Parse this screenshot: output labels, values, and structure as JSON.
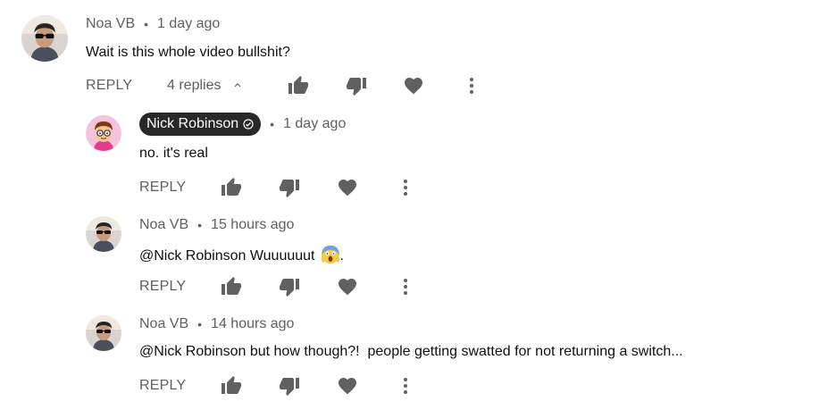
{
  "thread": {
    "top_comment": {
      "author": "Noa VB",
      "separator": "•",
      "time": "1 day ago",
      "text": "Wait is this whole video bullshit?",
      "reply_label": "REPLY",
      "replies_label": "4 replies"
    },
    "replies": [
      {
        "author": "Nick Robinson",
        "separator": "•",
        "time": "1 day ago",
        "text": "no. it's real",
        "reply_label": "REPLY"
      },
      {
        "author": "Noa VB",
        "separator": "•",
        "time": "15 hours ago",
        "text": "@Nick Robinson Wuuuuuut",
        "text_suffix": ".",
        "reply_label": "REPLY"
      },
      {
        "author": "Noa VB",
        "separator": "•",
        "time": "14 hours ago",
        "text": "@Nick Robinson but how though?!  people getting swatted for not returning a switch...",
        "reply_label": "REPLY"
      }
    ]
  },
  "colors": {
    "icon": "#606060",
    "text": "#0f0f0f",
    "meta": "#606060",
    "badge_bg": "#282828"
  },
  "icons": [
    "like-icon",
    "dislike-icon",
    "heart-icon",
    "more-vert-icon",
    "chevron-up-icon",
    "verified-icon",
    "screaming-emoji-icon"
  ]
}
